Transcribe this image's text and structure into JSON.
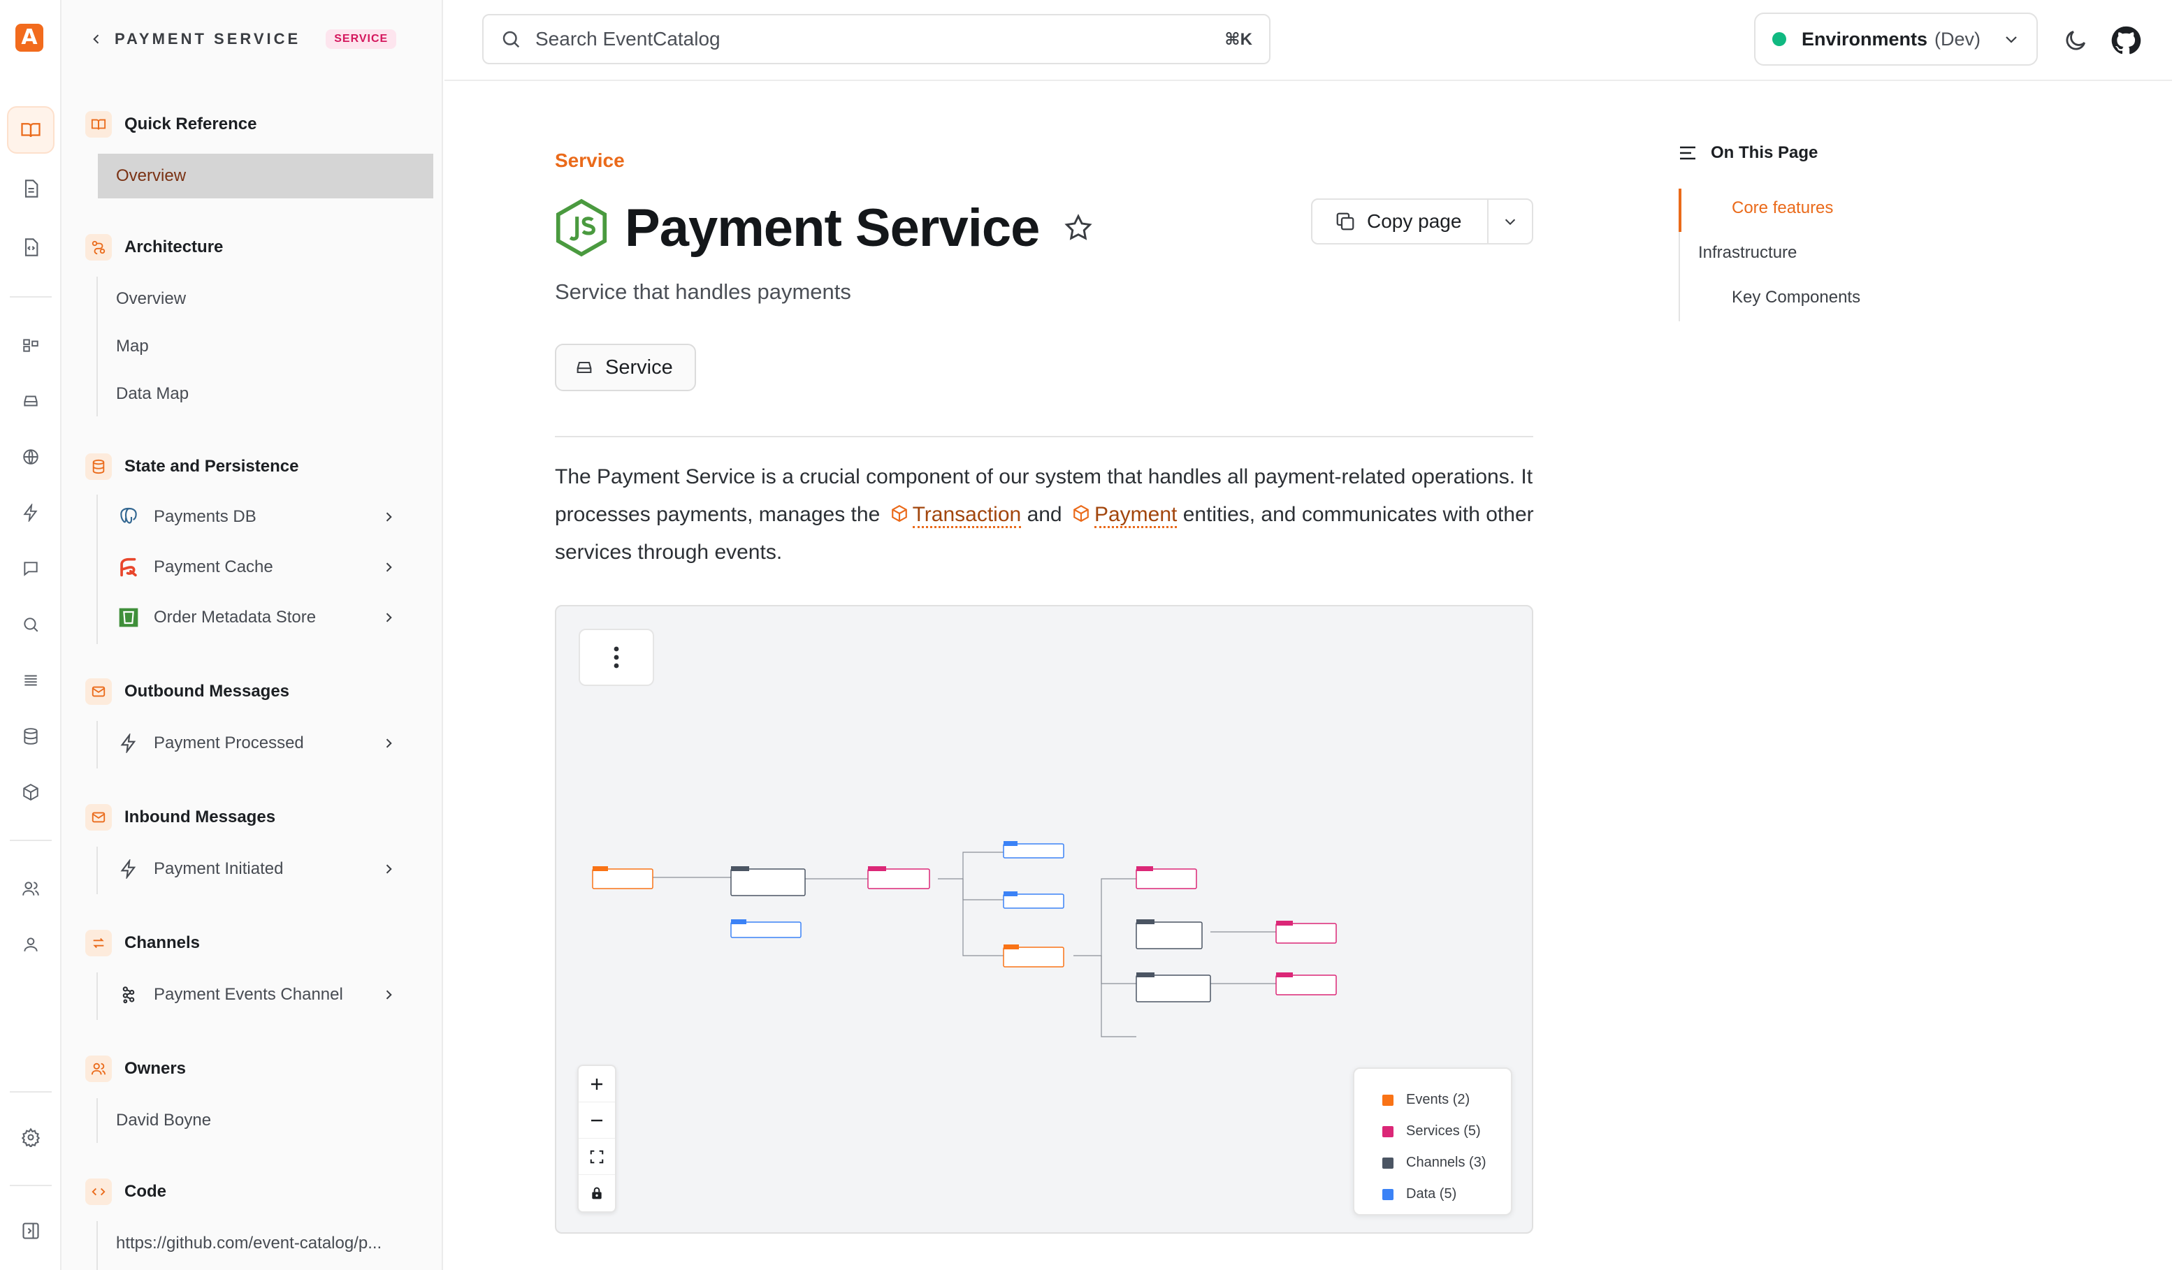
{
  "sidebar": {
    "title": "PAYMENT SERVICE",
    "badge": "SERVICE",
    "sections": {
      "quick_reference": "Quick Reference",
      "architecture": "Architecture",
      "state": "State and Persistence",
      "outbound": "Outbound Messages",
      "inbound": "Inbound Messages",
      "channels": "Channels",
      "owners": "Owners",
      "code": "Code"
    },
    "items": {
      "qr_overview": "Overview",
      "arch_overview": "Overview",
      "arch_map": "Map",
      "arch_data_map": "Data Map",
      "payments_db": "Payments DB",
      "payment_cache": "Payment Cache",
      "order_metadata_store": "Order Metadata Store",
      "payment_processed": "Payment Processed",
      "payment_initiated": "Payment Initiated",
      "payment_events_channel": "Payment Events Channel",
      "owner": "David Boyne",
      "code_link": "https://github.com/event-catalog/p..."
    }
  },
  "topbar": {
    "search_placeholder": "Search EventCatalog",
    "search_shortcut": "⌘K",
    "env_label": "Environments",
    "env_value": "(Dev)"
  },
  "main": {
    "eyebrow": "Service",
    "title": "Payment Service",
    "copy_label": "Copy page",
    "subtitle": "Service that handles payments",
    "tag": "Service",
    "para_1": "The Payment Service is a crucial component of our system that handles all payment-related operations. It processes payments, manages the",
    "entity_1": "Transaction",
    "para_2": "and",
    "entity_2": "Payment",
    "para_3": "entities, and communicates with other services through events."
  },
  "diagram": {
    "legend": {
      "events": "Events (2)",
      "services": "Services (5)",
      "channels": "Channels (3)",
      "data": "Data (5)"
    },
    "colors": {
      "events": "#f97316",
      "services": "#db2777",
      "channels": "#4b5563",
      "data": "#3b82f6"
    }
  },
  "toc": {
    "heading": "On This Page",
    "items": [
      "Core features",
      "Infrastructure",
      "Key Components"
    ]
  }
}
